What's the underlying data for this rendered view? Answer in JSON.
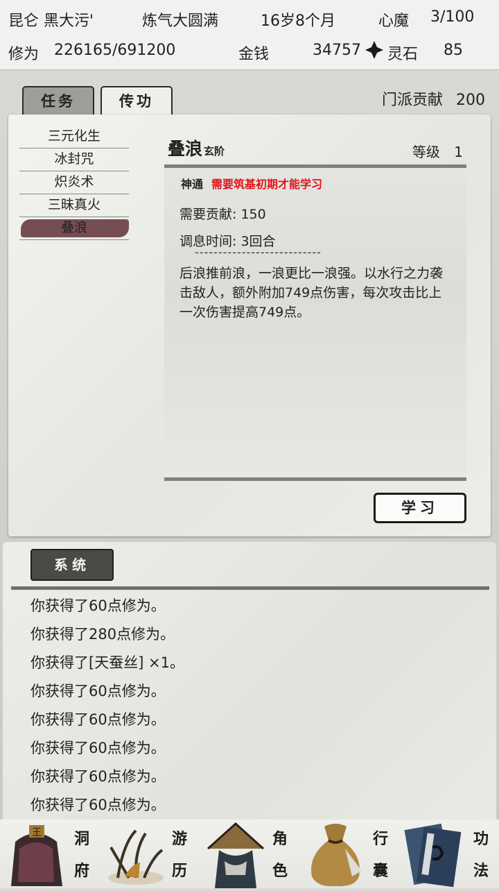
{
  "header": {
    "name": "昆仑 黑大污'",
    "realm": "炼气大圆满",
    "age": "16岁8个月",
    "demon_label": "心魔",
    "demon_value": "3/100",
    "cultivation_label": "修为",
    "cultivation_value": "226165/691200",
    "money_label": "金钱",
    "money_value": "34757",
    "spirit_label": "灵石",
    "spirit_value": "85"
  },
  "tabs": [
    {
      "label": "任务",
      "active": true
    },
    {
      "label": "传功",
      "active": false
    }
  ],
  "sect_contribution": {
    "label": "门派贡献",
    "value": "200"
  },
  "skill_list": [
    {
      "label": "三元化生",
      "selected": false
    },
    {
      "label": "冰封咒",
      "selected": false
    },
    {
      "label": "炽炎术",
      "selected": false
    },
    {
      "label": "三昧真火",
      "selected": false
    },
    {
      "label": "叠浪",
      "selected": true
    }
  ],
  "skill_detail": {
    "name": "叠浪",
    "grade": "玄阶",
    "level_label": "等级",
    "level_value": "1",
    "type": "神通",
    "requirement": "需要筑基初期才能学习",
    "cost": "需要贡献: 150",
    "cooldown": "调息时间: 3回合",
    "divider": "---------------------------",
    "description": "后浪推前浪，一浪更比一浪强。以水行之力袭击敌人，额外附加749点伤害，每次攻击比上一次伤害提高749点。"
  },
  "learn_button": "学习",
  "system": {
    "tab_label": "系统",
    "messages": [
      "你获得了60点修为。",
      "你获得了280点修为。",
      "你获得了[天蚕丝] ×1。",
      "你获得了60点修为。",
      "你获得了60点修为。",
      "你获得了60点修为。",
      "你获得了60点修为。",
      "你获得了60点修为。"
    ]
  },
  "nav": [
    {
      "top": "洞",
      "bottom": "府",
      "icon": "cave-dwelling-icon"
    },
    {
      "top": "游",
      "bottom": "历",
      "icon": "travel-icon"
    },
    {
      "top": "角",
      "bottom": "色",
      "icon": "character-icon"
    },
    {
      "top": "行",
      "bottom": "囊",
      "icon": "bag-icon"
    },
    {
      "top": "功",
      "bottom": "法",
      "icon": "technique-book-icon"
    }
  ],
  "colors": {
    "requirement_red": "#e0141a",
    "selected_brush": "#6b3f43",
    "active_tab": "#9e9e98"
  }
}
